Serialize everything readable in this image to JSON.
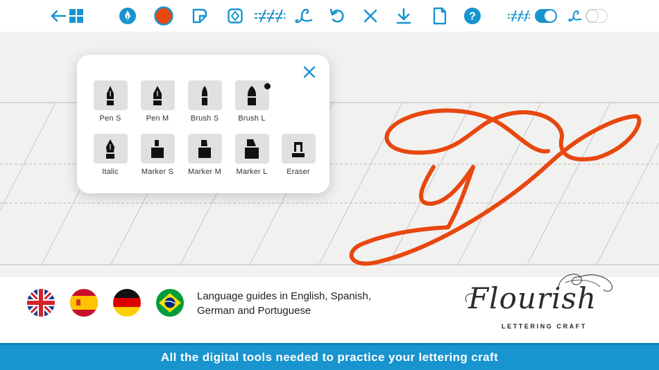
{
  "colors": {
    "accent": "#1894cf",
    "ink": "#e8470f",
    "toolbar_icon": "#1894cf"
  },
  "toolbar": {
    "icons": [
      "back-arrow-icon",
      "grid-icon",
      "pen-nib-icon",
      "color-swatch-icon",
      "paper-icon",
      "stamp-icon",
      "guidelines-icon",
      "letter-guide-icon",
      "undo-icon",
      "clear-icon",
      "download-icon",
      "document-icon",
      "help-icon"
    ],
    "toggles": [
      {
        "name": "guidelines-toggle",
        "on": true
      },
      {
        "name": "letter-guide-toggle",
        "on": false
      }
    ]
  },
  "tools": [
    {
      "label": "Pen S",
      "icon": "fountain-pen-small-icon"
    },
    {
      "label": "Pen M",
      "icon": "fountain-pen-medium-icon"
    },
    {
      "label": "Brush S",
      "icon": "brush-small-icon"
    },
    {
      "label": "Brush L",
      "icon": "brush-large-icon",
      "selected_dot": true
    },
    {
      "label": "Italic",
      "icon": "italic-pen-icon"
    },
    {
      "label": "Marker S",
      "icon": "marker-small-icon"
    },
    {
      "label": "Marker M",
      "icon": "marker-medium-icon"
    },
    {
      "label": "Marker L",
      "icon": "marker-large-icon"
    },
    {
      "label": "Eraser",
      "icon": "eraser-icon"
    }
  ],
  "info": {
    "flags": [
      "uk-flag-icon",
      "spain-flag-icon",
      "germany-flag-icon",
      "brazil-flag-icon"
    ],
    "language_text_line1": "Language guides in English, Spanish,",
    "language_text_line2": "German and Portuguese",
    "logo_word": "Flourish",
    "logo_subtitle": "LETTERING CRAFT"
  },
  "banner": {
    "text": "All the digital tools needed to practice your lettering craft"
  }
}
